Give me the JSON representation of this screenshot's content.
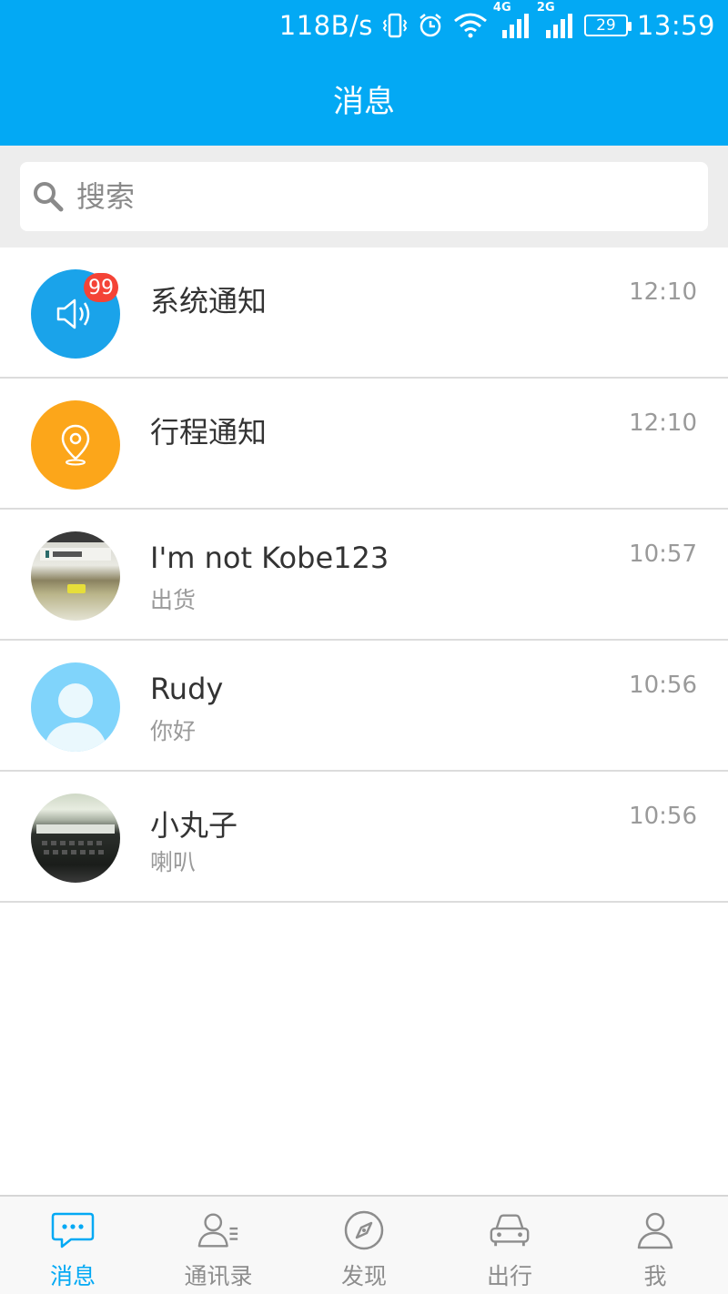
{
  "status_bar": {
    "speed": "118B/s",
    "net1": "4G",
    "net2": "2G",
    "battery": "29",
    "time": "13:59"
  },
  "header": {
    "title": "消息"
  },
  "search": {
    "placeholder": "搜索"
  },
  "conversations": [
    {
      "name": "系统通知",
      "message": "",
      "time": "12:10",
      "badge": "99",
      "avatar": "speaker-icon",
      "color": "#1aa3ea"
    },
    {
      "name": "行程通知",
      "message": "",
      "time": "12:10",
      "badge": "",
      "avatar": "location-pin-icon",
      "color": "#fca61a"
    },
    {
      "name": "I'm not Kobe123",
      "message": "出货",
      "time": "10:57",
      "avatar": "photo"
    },
    {
      "name": "Rudy",
      "message": "你好",
      "time": "10:56",
      "avatar": "default-person-icon",
      "color": "#80d4fb"
    },
    {
      "name": "小丸子",
      "message": "喇叭",
      "time": "10:56",
      "avatar": "photo"
    }
  ],
  "nav": [
    {
      "label": "消息",
      "icon": "chat-bubble-icon",
      "active": true
    },
    {
      "label": "通讯录",
      "icon": "contacts-icon",
      "active": false
    },
    {
      "label": "发现",
      "icon": "compass-icon",
      "active": false
    },
    {
      "label": "出行",
      "icon": "car-icon",
      "active": false
    },
    {
      "label": "我",
      "icon": "person-icon",
      "active": false
    }
  ],
  "colors": {
    "primary": "#03a9f4",
    "badge": "#f44336",
    "divider": "#dcdcdc"
  }
}
